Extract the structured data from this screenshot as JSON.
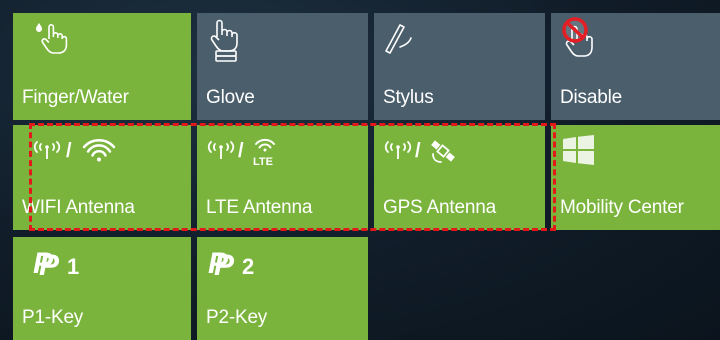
{
  "tiles": [
    {
      "id": "finger-water",
      "label": "Finger/Water",
      "icon": "finger-water-touch-icon",
      "color": "#7ab43c"
    },
    {
      "id": "glove",
      "label": "Glove",
      "icon": "glove-touch-icon",
      "color": "#4b5e6c"
    },
    {
      "id": "stylus",
      "label": "Stylus",
      "icon": "stylus-pen-icon",
      "color": "#4b5e6c"
    },
    {
      "id": "disable",
      "label": "Disable",
      "icon": "touch-disabled-icon",
      "color": "#4b5e6c"
    },
    {
      "id": "wifi-antenna",
      "label": "WIFI Antenna",
      "icon": "antenna-wifi-icon",
      "color": "#7ab43c"
    },
    {
      "id": "lte-antenna",
      "label": "LTE Antenna",
      "icon": "antenna-lte-icon",
      "color": "#7ab43c"
    },
    {
      "id": "gps-antenna",
      "label": "GPS Antenna",
      "icon": "antenna-gps-icon",
      "color": "#7ab43c"
    },
    {
      "id": "mobility-center",
      "label": "Mobility Center",
      "icon": "windows-logo-icon",
      "color": "#7ab43c"
    },
    {
      "id": "p1-key",
      "label": "P1-Key",
      "icon": "p1-key-icon",
      "color": "#7ab43c"
    },
    {
      "id": "p2-key",
      "label": "P2-Key",
      "icon": "p2-key-icon",
      "color": "#7ab43c"
    }
  ],
  "icons": {
    "lte_text": "LTE",
    "slash": "/",
    "p1_digit": "1",
    "p2_digit": "2"
  },
  "highlight": {
    "color": "#e2191a",
    "style": "dashed"
  }
}
